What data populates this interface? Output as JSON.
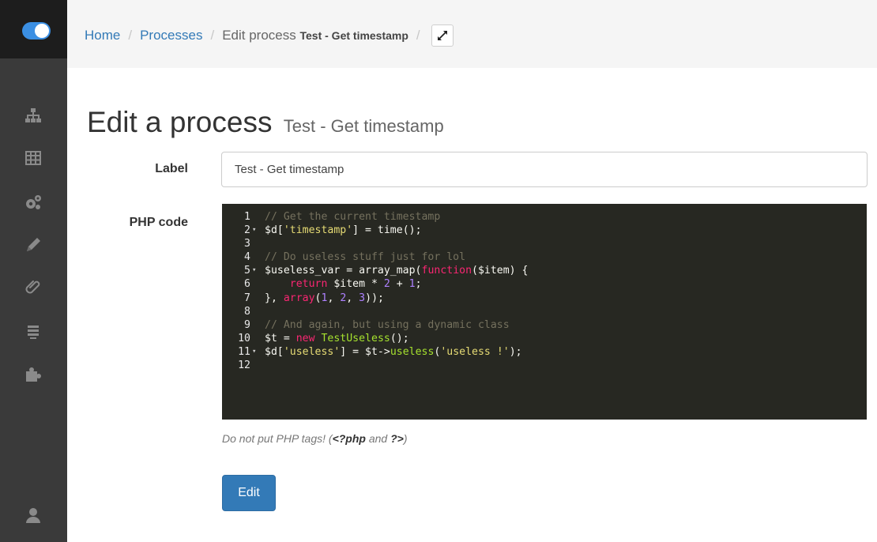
{
  "colors": {
    "sidebar_bg": "#3a3a3a",
    "sidebar_top_bg": "#1d1d1d",
    "header_bg": "#f5f5f5",
    "link": "#337ab7",
    "primary_button": "#337ab7",
    "editor_bg": "#272822"
  },
  "sidebar": {
    "logo_icon": "toggle-logo-icon",
    "items": [
      {
        "icon": "sitemap-icon"
      },
      {
        "icon": "table-icon"
      },
      {
        "icon": "gears-icon"
      },
      {
        "icon": "pencil-icon"
      },
      {
        "icon": "paperclip-icon"
      },
      {
        "icon": "list-icon"
      },
      {
        "icon": "puzzle-icon"
      }
    ],
    "bottom_icon": "user-icon"
  },
  "breadcrumb": {
    "home": "Home",
    "processes": "Processes",
    "current_prefix": "Edit process",
    "current_name": "Test - Get timestamp",
    "expand_icon": "expand-icon"
  },
  "page": {
    "title": "Edit a process",
    "subtitle": "Test - Get timestamp"
  },
  "form": {
    "label_field_label": "Label",
    "label_value": "Test - Get timestamp",
    "code_field_label": "PHP code",
    "help_prefix": "Do not put PHP tags! (",
    "help_tag_open": "<?php",
    "help_and": " and ",
    "help_tag_close": "?>",
    "help_suffix": ")",
    "submit_label": "Edit"
  },
  "code": {
    "lines": [
      {
        "num": "1",
        "fold": false,
        "tokens": [
          {
            "t": "comment",
            "v": "// Get the current timestamp"
          }
        ]
      },
      {
        "num": "2",
        "fold": true,
        "tokens": [
          {
            "t": "var",
            "v": "$d["
          },
          {
            "t": "string",
            "v": "'timestamp'"
          },
          {
            "t": "var",
            "v": "] = time();"
          }
        ]
      },
      {
        "num": "3",
        "fold": false,
        "tokens": []
      },
      {
        "num": "4",
        "fold": false,
        "tokens": [
          {
            "t": "comment",
            "v": "// Do useless stuff just for lol"
          }
        ]
      },
      {
        "num": "5",
        "fold": true,
        "tokens": [
          {
            "t": "var",
            "v": "$useless_var = array_map("
          },
          {
            "t": "keyword",
            "v": "function"
          },
          {
            "t": "var",
            "v": "($item) {"
          }
        ]
      },
      {
        "num": "6",
        "fold": false,
        "tokens": [
          {
            "t": "var",
            "v": "    "
          },
          {
            "t": "keyword",
            "v": "return"
          },
          {
            "t": "var",
            "v": " $item * "
          },
          {
            "t": "number",
            "v": "2"
          },
          {
            "t": "var",
            "v": " + "
          },
          {
            "t": "number",
            "v": "1"
          },
          {
            "t": "var",
            "v": ";"
          }
        ]
      },
      {
        "num": "7",
        "fold": false,
        "tokens": [
          {
            "t": "var",
            "v": "}, "
          },
          {
            "t": "keyword",
            "v": "array"
          },
          {
            "t": "var",
            "v": "("
          },
          {
            "t": "number",
            "v": "1"
          },
          {
            "t": "var",
            "v": ", "
          },
          {
            "t": "number",
            "v": "2"
          },
          {
            "t": "var",
            "v": ", "
          },
          {
            "t": "number",
            "v": "3"
          },
          {
            "t": "var",
            "v": "));"
          }
        ]
      },
      {
        "num": "8",
        "fold": false,
        "tokens": []
      },
      {
        "num": "9",
        "fold": false,
        "tokens": [
          {
            "t": "comment",
            "v": "// And again, but using a dynamic class"
          }
        ]
      },
      {
        "num": "10",
        "fold": false,
        "tokens": [
          {
            "t": "var",
            "v": "$t = "
          },
          {
            "t": "keyword",
            "v": "new"
          },
          {
            "t": "var",
            "v": " "
          },
          {
            "t": "func",
            "v": "TestUseless"
          },
          {
            "t": "var",
            "v": "();"
          }
        ]
      },
      {
        "num": "11",
        "fold": true,
        "tokens": [
          {
            "t": "var",
            "v": "$d["
          },
          {
            "t": "string",
            "v": "'useless'"
          },
          {
            "t": "var",
            "v": "] = $t->"
          },
          {
            "t": "func",
            "v": "useless"
          },
          {
            "t": "var",
            "v": "("
          },
          {
            "t": "string",
            "v": "'useless !'"
          },
          {
            "t": "var",
            "v": ");"
          }
        ]
      },
      {
        "num": "12",
        "fold": false,
        "tokens": []
      }
    ]
  }
}
